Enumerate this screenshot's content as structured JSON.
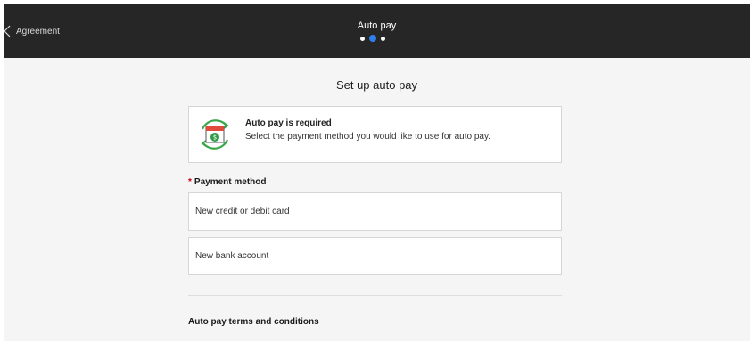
{
  "header": {
    "back_label": "Agreement",
    "title": "Auto pay",
    "steps_total": 3,
    "active_step": 2,
    "background": "#262626",
    "accent": "#2f80ed"
  },
  "main": {
    "title": "Set up auto pay",
    "info": {
      "icon": "calendar-dollar-refresh-icon",
      "title": "Auto pay is required",
      "text": "Select the payment method you would like to use for auto pay."
    },
    "payment_method": {
      "required_marker": "*",
      "label": "Payment method",
      "options": [
        {
          "label": "New credit or debit card"
        },
        {
          "label": "New bank account"
        }
      ]
    },
    "terms_heading": "Auto pay terms and conditions"
  }
}
